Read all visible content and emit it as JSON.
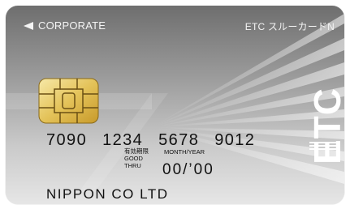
{
  "card": {
    "brand_label": "CORPORATE",
    "product_name": "ETC スルーカードN",
    "number_groups": [
      "7090",
      "1234",
      "5678",
      "9012"
    ],
    "valid_label_jp": "有効期限",
    "valid_label_good": "GOOD",
    "valid_label_thru": "THRU",
    "month_year_label": "MONTH/YEAR",
    "expiry": "00/’00",
    "holder_name": "NIPPON CO LTD",
    "logo_text": "ETC"
  }
}
